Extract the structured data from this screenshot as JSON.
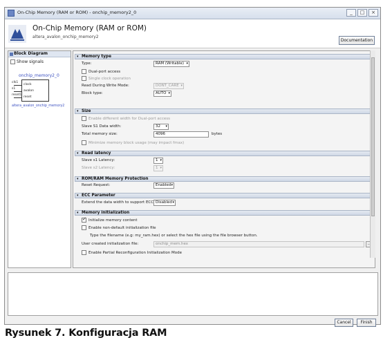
{
  "window": {
    "title": "On-Chip Memory (RAM or ROM) - onchip_memory2_0",
    "buttons": [
      "_",
      "□",
      "×"
    ]
  },
  "header": {
    "ip_title": "On-Chip Memory (RAM or ROM)",
    "ip_subtitle": "altera_avalon_onchip_memory2",
    "logo": "altera-logo",
    "documentation_label": "Documentation"
  },
  "block_diagram": {
    "header": "Block Diagram",
    "show_signals_label": "Show signals",
    "show_signals_checked": false,
    "instance_name": "onchip_memory2_0",
    "left_pins": [
      "clk1",
      "s1",
      "reset1"
    ],
    "right_pins": [
      "clock",
      "avalon",
      "reset"
    ],
    "component": "altera_avalon_onchip_memory2"
  },
  "memory_type": {
    "header": "Memory type",
    "type_label": "Type:",
    "type_value": "RAM (Writable)",
    "dual_port_label": "Dual-port access",
    "single_clock_label": "Single clock operation",
    "rdw_label": "Read During Write Mode:",
    "rdw_value": "DONT_CARE",
    "block_type_label": "Block type:",
    "block_type_value": "AUTO"
  },
  "size": {
    "header": "Size",
    "diff_width_label": "Enable different width for Dual-port access",
    "data_width_label": "Slave S1 Data width:",
    "data_width_value": "32",
    "total_size_label": "Total memory size:",
    "total_size_value": "4096",
    "total_size_unit": "bytes",
    "minimize_label": "Minimize memory block usage (may impact fmax)"
  },
  "read_latency": {
    "header": "Read latency",
    "s1_label": "Slave s1 Latency:",
    "s1_value": "1",
    "s2_label": "Slave s2 Latency:",
    "s2_value": "1"
  },
  "rom_protection": {
    "header": "ROM/RAM Memory Protection",
    "reset_request_label": "Reset Request:",
    "reset_request_value": "Enabled"
  },
  "ecc": {
    "header": "ECC Parameter",
    "extend_label": "Extend the data width to support ECC bits:",
    "extend_value": "Disabled"
  },
  "mem_init": {
    "header": "Memory initialization",
    "init_content_label": "Initialize memory content",
    "init_content_checked": true,
    "non_default_label": "Enable non-default initialization file",
    "instruction": "Type the filename (e.g: my_ram.hex) or select the hex file using the file browser button.",
    "user_file_label": "User created initialization file:",
    "user_file_value": "onchip_mem.hex",
    "browse_label": "...",
    "partial_reconfig_label": "Enable Partial Reconfiguration Initialization Mode"
  },
  "footer": {
    "cancel_label": "Cancel",
    "finish_label": "Finish"
  },
  "caption": "Rysunek 7. Konfiguracja RAM"
}
